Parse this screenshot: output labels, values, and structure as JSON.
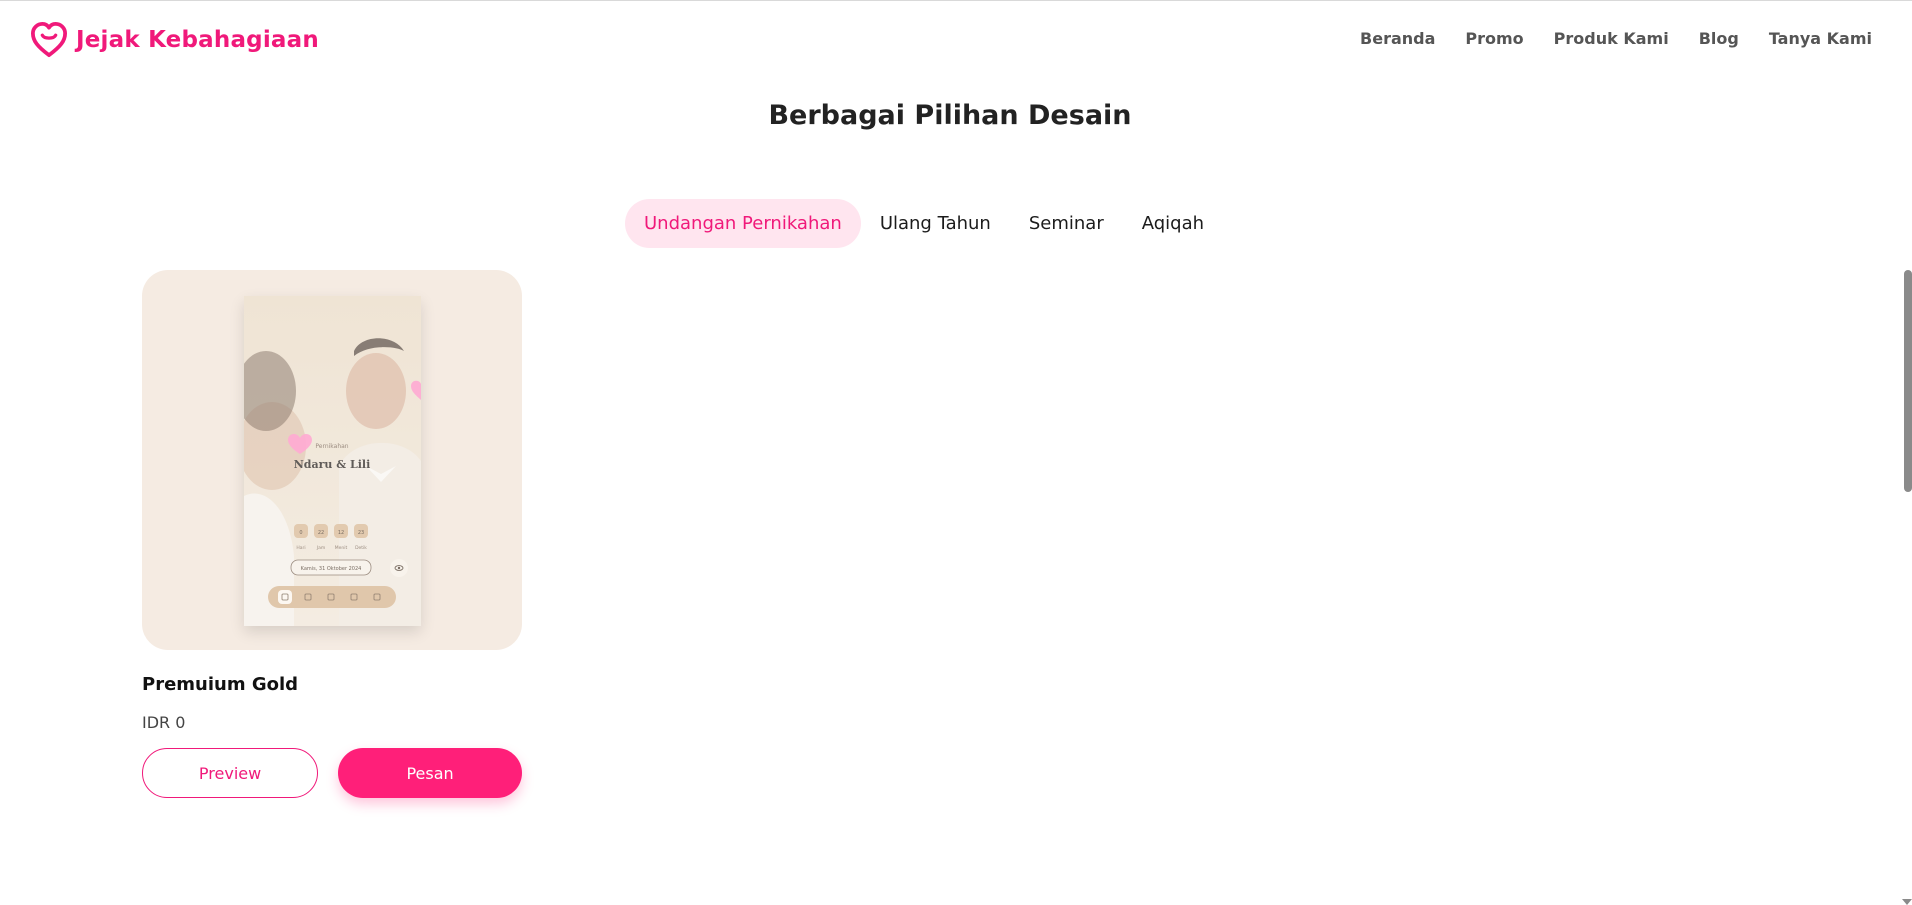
{
  "brand": {
    "name": "Jejak Kebahagiaan",
    "logo_icon": "heart-logo-icon",
    "color": "#f0197a"
  },
  "nav": [
    {
      "label": "Beranda"
    },
    {
      "label": "Promo"
    },
    {
      "label": "Produk Kami"
    },
    {
      "label": "Blog"
    },
    {
      "label": "Tanya Kami"
    }
  ],
  "section": {
    "title": "Berbagai Pilihan Desain"
  },
  "tabs": [
    {
      "label": "Undangan Pernikahan",
      "active": true
    },
    {
      "label": "Ulang Tahun",
      "active": false
    },
    {
      "label": "Seminar",
      "active": false
    },
    {
      "label": "Aqiqah",
      "active": false
    }
  ],
  "products": [
    {
      "name": "Premuium Gold",
      "price": "IDR 0",
      "preview_label": "Preview",
      "order_label": "Pesan",
      "thumbnail": {
        "subtitle": "Pernikahan",
        "couple": "Ndaru & Lili",
        "countdown": [
          {
            "value": "0",
            "unit": "Hari"
          },
          {
            "value": "22",
            "unit": "Jam"
          },
          {
            "value": "12",
            "unit": "Menit"
          },
          {
            "value": "23",
            "unit": "Detik"
          }
        ],
        "date": "Kamis, 31 Oktober 2024"
      }
    }
  ],
  "colors": {
    "accent": "#f0197a",
    "button": "#ff1f79",
    "tab_active_bg": "#ffe5ef",
    "card_bg": "#f5ebe2"
  }
}
